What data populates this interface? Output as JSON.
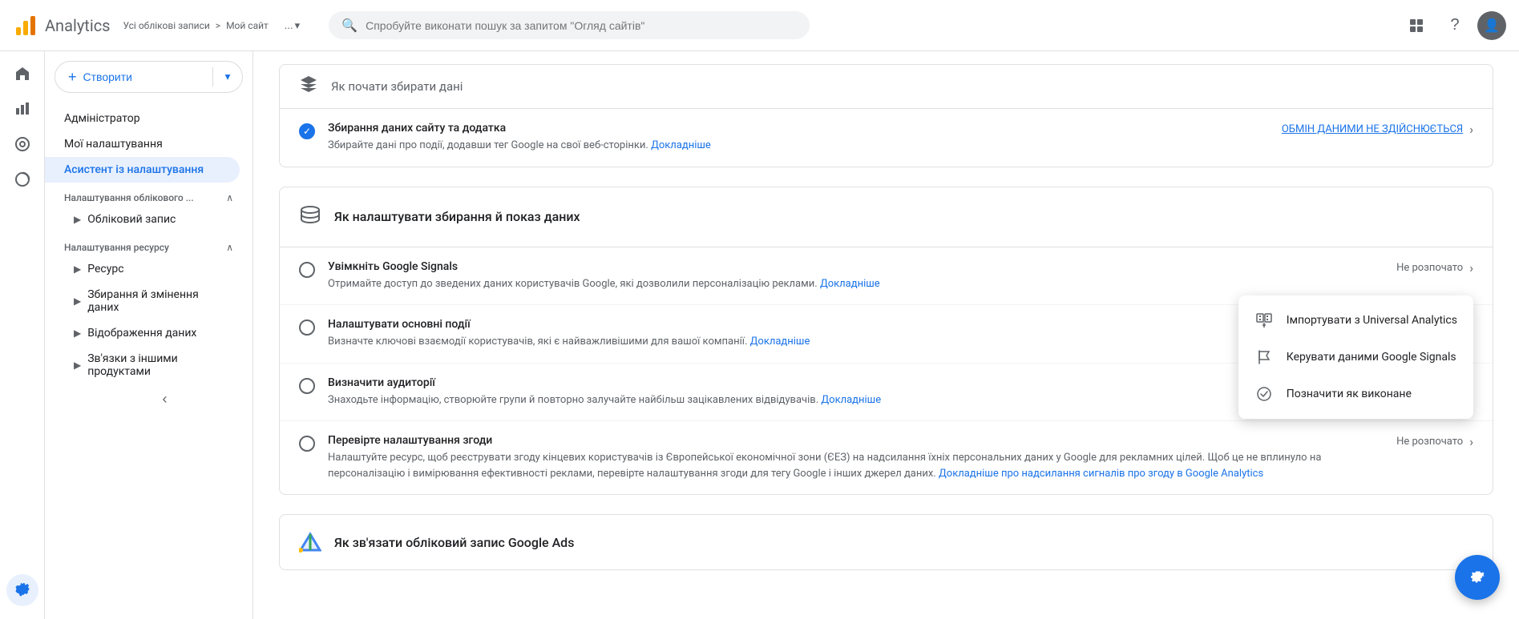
{
  "header": {
    "app_name": "Analytics",
    "breadcrumb_part1": "Усі облікові записи",
    "breadcrumb_sep": ">",
    "breadcrumb_part2": "Мой сайт",
    "more_label": "...",
    "search_placeholder": "Спробуйте виконати пошук за запитом \"Огляд сайтів\""
  },
  "sidebar_icons": {
    "home": "⌂",
    "bar_chart": "▦",
    "search_analytics": "◎",
    "signal": "📡",
    "settings": "⚙"
  },
  "sidebar_nav": {
    "create_button": "Створити",
    "admin_label": "Адміністратор",
    "my_settings_label": "Мої налаштування",
    "setup_assistant_label": "Асистент із налаштування",
    "account_settings_header": "Налаштування облікового ...",
    "account_record_label": "Обліковий запис",
    "resource_settings_header": "Налаштування ресурсу",
    "resource_label": "Ресурс",
    "data_collection_label": "Збирання й змінення даних",
    "data_display_label": "Відображення даних",
    "product_links_label": "Зв'язки з іншими продуктами"
  },
  "main": {
    "partial_section_title": "Як почати збирати дані",
    "data_collection_task": {
      "title": "Збирання даних сайту та додатка",
      "description": "Збирайте дані про події, додавши тег Google на свої веб-сторінки.",
      "link_text": "Докладніше",
      "status": "ОБМІН ДАНИМИ НЕ ЗДІЙСНЮЄТЬСЯ"
    },
    "section2_title": "Як налаштувати збирання й показ даних",
    "section2_icon": "⚡",
    "tasks": [
      {
        "id": "google_signals",
        "title": "Увімкніть Google Signals",
        "description": "Отримайте доступ до зведених даних користувачів Google, які дозволили персоналізацію реклами.",
        "link_text": "Докладніше",
        "status": "Не розпочато",
        "done": false
      },
      {
        "id": "key_events",
        "title": "Налаштувати основні події",
        "description": "Визначте ключові взаємодії користувачів, які є найважливішими для вашої компанії.",
        "link_text": "Докладніше",
        "status": "",
        "done": false
      },
      {
        "id": "audiences",
        "title": "Визначити аудиторії",
        "description": "Знаходьте інформацію, створюйте групи й повторно залучайте найбільш зацікавлених відвідувачів.",
        "link_text": "Докладніше",
        "status": "",
        "done": false
      },
      {
        "id": "consent",
        "title": "Перевірте налаштування згоди",
        "description": "Налаштуйте ресурс, щоб реєструвати згоду кінцевих користувачів із Європейської економічної зони (ЄЕЗ) на надсилання їхніх персональних даних у Google для рекламних цілей. Щоб це не вплинуло на персоналізацію і вимірювання ефективності реклами, перевірте налаштування згоди для тегу Google і інших джерел даних.",
        "link_text": "Докладніше про надсилання сигналів про згоду в Google Analytics",
        "status": "Не розпочато",
        "done": false
      }
    ],
    "google_ads_section_title": "Як зв'язати обліковий запис Google Ads"
  },
  "dropdown_menu": {
    "items": [
      {
        "id": "import_ua",
        "label": "Імпортувати з Universal Analytics",
        "icon": "import"
      },
      {
        "id": "manage_signals",
        "label": "Керувати даними Google Signals",
        "icon": "flag"
      },
      {
        "id": "mark_done",
        "label": "Позначити як виконане",
        "icon": "check"
      }
    ]
  },
  "fab": {
    "icon": "⚙"
  },
  "colors": {
    "accent": "#1a73e8",
    "success": "#34a853",
    "text_secondary": "#5f6368",
    "border": "#e0e0e0"
  }
}
